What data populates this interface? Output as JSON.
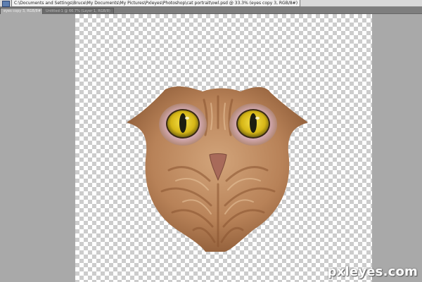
{
  "window": {
    "title_path": "C:\\Documents and Settings\\Bruce\\My Documents\\My Pictures\\Pxleyes\\Photoshop\\cat portrait\\owl.psd @ 33.3% (eyes copy 3, RGB/8#)"
  },
  "tabs": [
    {
      "label": "eyes copy 3, RGB/8#",
      "active": true
    },
    {
      "label": "Untitled-1 @ 66.7% (Layer 1, RGB/8)",
      "active": false
    }
  ],
  "watermark": {
    "text": "pxleyes.com"
  },
  "colors": {
    "fur_light": "#c8956a",
    "fur_dark": "#8a5a38",
    "eye_iris": "#e2c81c",
    "eye_pupil": "#1d1d10",
    "beak": "#a86a5a"
  }
}
